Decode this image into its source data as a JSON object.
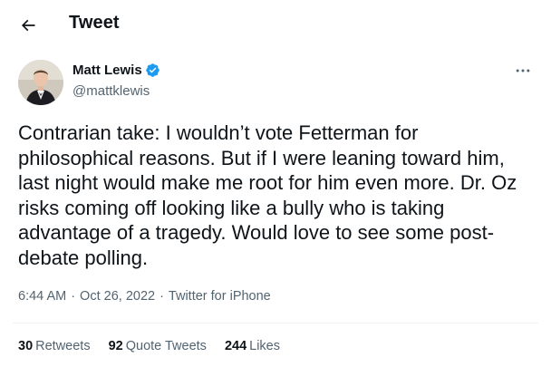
{
  "header": {
    "title": "Tweet",
    "back_icon": "arrow-left-icon"
  },
  "author": {
    "name": "Matt Lewis",
    "handle": "@mattklewis",
    "verified": true,
    "verified_color": "#1d9bf0"
  },
  "tweet": {
    "text": "Contrarian take: I wouldn’t vote Fetterman for philosophical reasons. But if I were leaning toward him, last night would make me root for him even more. Dr. Oz risks coming off looking like a bully who is taking advantage of a tragedy. Would love to see some post-debate polling."
  },
  "meta": {
    "time": "6:44 AM",
    "separator": "·",
    "date": "Oct 26, 2022",
    "source": "Twitter for iPhone"
  },
  "stats": {
    "retweets": "30",
    "retweets_label": "Retweets",
    "quotes": "92",
    "quotes_label": "Quote Tweets",
    "likes": "244",
    "likes_label": "Likes"
  },
  "colors": {
    "text_primary": "#0f1419",
    "text_secondary": "#536471",
    "divider": "#eff3f4",
    "background": "#ffffff"
  }
}
